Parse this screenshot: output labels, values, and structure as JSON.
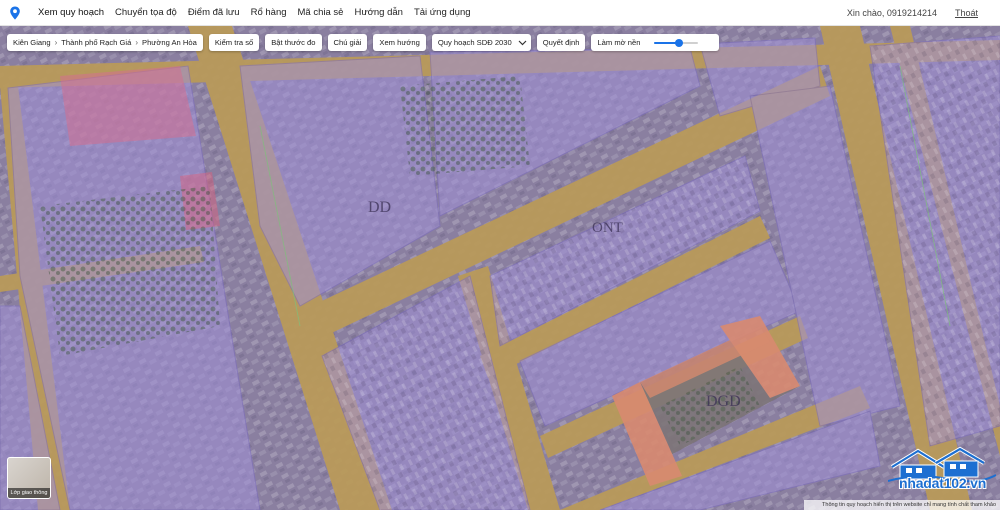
{
  "nav": {
    "items": [
      "Xem quy hoạch",
      "Chuyển tọa độ",
      "Điểm đã lưu",
      "Rổ hàng",
      "Mã chia sẻ",
      "Hướng dẫn",
      "Tải ứng dụng"
    ],
    "greeting": "Xin chào, 0919214214",
    "logout": "Thoát"
  },
  "toolbar": {
    "breadcrumb": [
      "Kiên Giang",
      "Thành phố Rạch Giá",
      "Phường An Hòa"
    ],
    "check_land": "Kiểm tra số",
    "measure": "Bật thước đo",
    "legend": "Chú giải",
    "direction": "Xem hướng",
    "plan_select": "Quy hoạch SDĐ 2030",
    "decision": "Quyết định",
    "blur_label": "Làm mờ nền",
    "blur_level": 0.55
  },
  "map": {
    "zone_labels": [
      "DD",
      "ONT",
      "DGD"
    ]
  },
  "layer": {
    "label": "Lớp giao thông"
  },
  "watermark": {
    "text": "nhadat102.vn"
  },
  "footer": {
    "text": "Thông tin quy hoạch hiển thị trên website chỉ mang tính chất tham khảo"
  },
  "colors": {
    "accent": "#1a73e8",
    "zone_purple": "#9f8fd2",
    "road": "#c7a35a",
    "school": "#d98a70"
  }
}
